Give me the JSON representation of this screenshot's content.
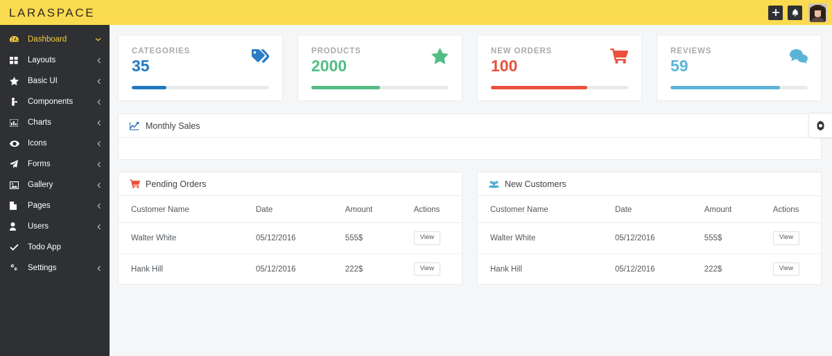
{
  "brand": {
    "logo_text": "LARASPACE",
    "yellow": "#fada4e",
    "sidebar_bg": "#2e3033",
    "active_color": "#f6cd3c"
  },
  "sidebar": {
    "items": [
      {
        "label": "Dashboard",
        "icon": "dashboard-icon",
        "arrow": "chevron-down",
        "active": true
      },
      {
        "label": "Layouts",
        "icon": "layouts-icon",
        "arrow": "chevron-left",
        "active": false
      },
      {
        "label": "Basic UI",
        "icon": "star-icon",
        "arrow": "chevron-left",
        "active": false
      },
      {
        "label": "Components",
        "icon": "components-icon",
        "arrow": "chevron-left",
        "active": false
      },
      {
        "label": "Charts",
        "icon": "chart-bar-icon",
        "arrow": "chevron-left",
        "active": false
      },
      {
        "label": "Icons",
        "icon": "eye-icon",
        "arrow": "chevron-left",
        "active": false
      },
      {
        "label": "Forms",
        "icon": "paper-plane-icon",
        "arrow": "chevron-left",
        "active": false
      },
      {
        "label": "Gallery",
        "icon": "image-icon",
        "arrow": "chevron-left",
        "active": false
      },
      {
        "label": "Pages",
        "icon": "file-icon",
        "arrow": "chevron-left",
        "active": false
      },
      {
        "label": "Users",
        "icon": "user-icon",
        "arrow": "chevron-left",
        "active": false
      },
      {
        "label": "Todo App",
        "icon": "check-icon",
        "arrow": "",
        "active": false
      },
      {
        "label": "Settings",
        "icon": "gears-icon",
        "arrow": "chevron-left",
        "active": false
      }
    ]
  },
  "topbar": {
    "add_button": "+",
    "notifications_button": "bell-icon",
    "avatar": "user-avatar"
  },
  "stats": [
    {
      "title": "CATEGORIES",
      "value": "35",
      "color": "#2079c0",
      "icon": "tag-icon",
      "progress": 25
    },
    {
      "title": "PRODUCTS",
      "value": "2000",
      "color": "#53bd84",
      "icon": "star-icon",
      "progress": 50
    },
    {
      "title": "NEW ORDERS",
      "value": "100",
      "color": "#e8513c",
      "icon": "cart-icon",
      "progress": 70
    },
    {
      "title": "REVIEWS",
      "value": "59",
      "color": "#5bb4d8",
      "icon": "comments-icon",
      "progress": 80
    }
  ],
  "chart_panel": {
    "title": "Monthly Sales",
    "icon": "line-chart-icon"
  },
  "tables": [
    {
      "title": "Pending Orders",
      "icon": "cart-icon",
      "columns": [
        "Customer Name",
        "Date",
        "Amount",
        "Actions"
      ],
      "rows": [
        {
          "name": "Walter White",
          "date": "05/12/2016",
          "amount": "555$",
          "action": "View"
        },
        {
          "name": "Hank Hill",
          "date": "05/12/2016",
          "amount": "222$",
          "action": "View"
        }
      ]
    },
    {
      "title": "New Customers",
      "icon": "users-icon",
      "columns": [
        "Customer Name",
        "Date",
        "Amount",
        "Actions"
      ],
      "rows": [
        {
          "name": "Walter White",
          "date": "05/12/2016",
          "amount": "555$",
          "action": "View"
        },
        {
          "name": "Hank Hill",
          "date": "05/12/2016",
          "amount": "222$",
          "action": "View"
        }
      ]
    }
  ],
  "settings_fab": {
    "icon": "gear-icon"
  }
}
